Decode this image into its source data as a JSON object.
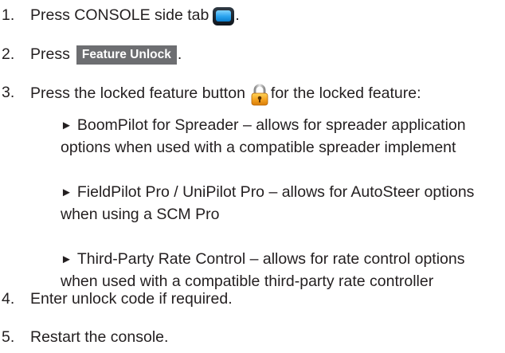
{
  "steps": [
    {
      "num": "1.",
      "text_before": "Press CONSOLE side tab",
      "text_after": ".",
      "icon": "console-tab-icon"
    },
    {
      "num": "2.",
      "text_before": "Press",
      "button_label": "Feature Unlock",
      "text_after": "."
    },
    {
      "num": "3.",
      "text_before": "Press the locked feature button",
      "text_after": " for the locked feature:",
      "icon": "lock-icon"
    },
    {
      "num": "4.",
      "text": "Enter unlock code if required."
    },
    {
      "num": "5.",
      "text": "Restart the console."
    }
  ],
  "features": [
    {
      "arrow": "►",
      "lines": [
        "BoomPilot for Spreader – allows for spreader application",
        "options when used with a compatible spreader implement"
      ]
    },
    {
      "arrow": "►",
      "lines": [
        "FieldPilot Pro / UniPilot Pro – allows for AutoSteer options",
        "when using a SCM Pro"
      ]
    },
    {
      "arrow": "►",
      "lines": [
        "Third-Party Rate Control – allows for rate control options",
        "when used with a compatible third-party rate controller"
      ]
    }
  ],
  "colors": {
    "text": "#231f20",
    "button_bg": "#6d6e71",
    "lock_body": "#f5a623",
    "console_screen": "#2aa3ee"
  }
}
